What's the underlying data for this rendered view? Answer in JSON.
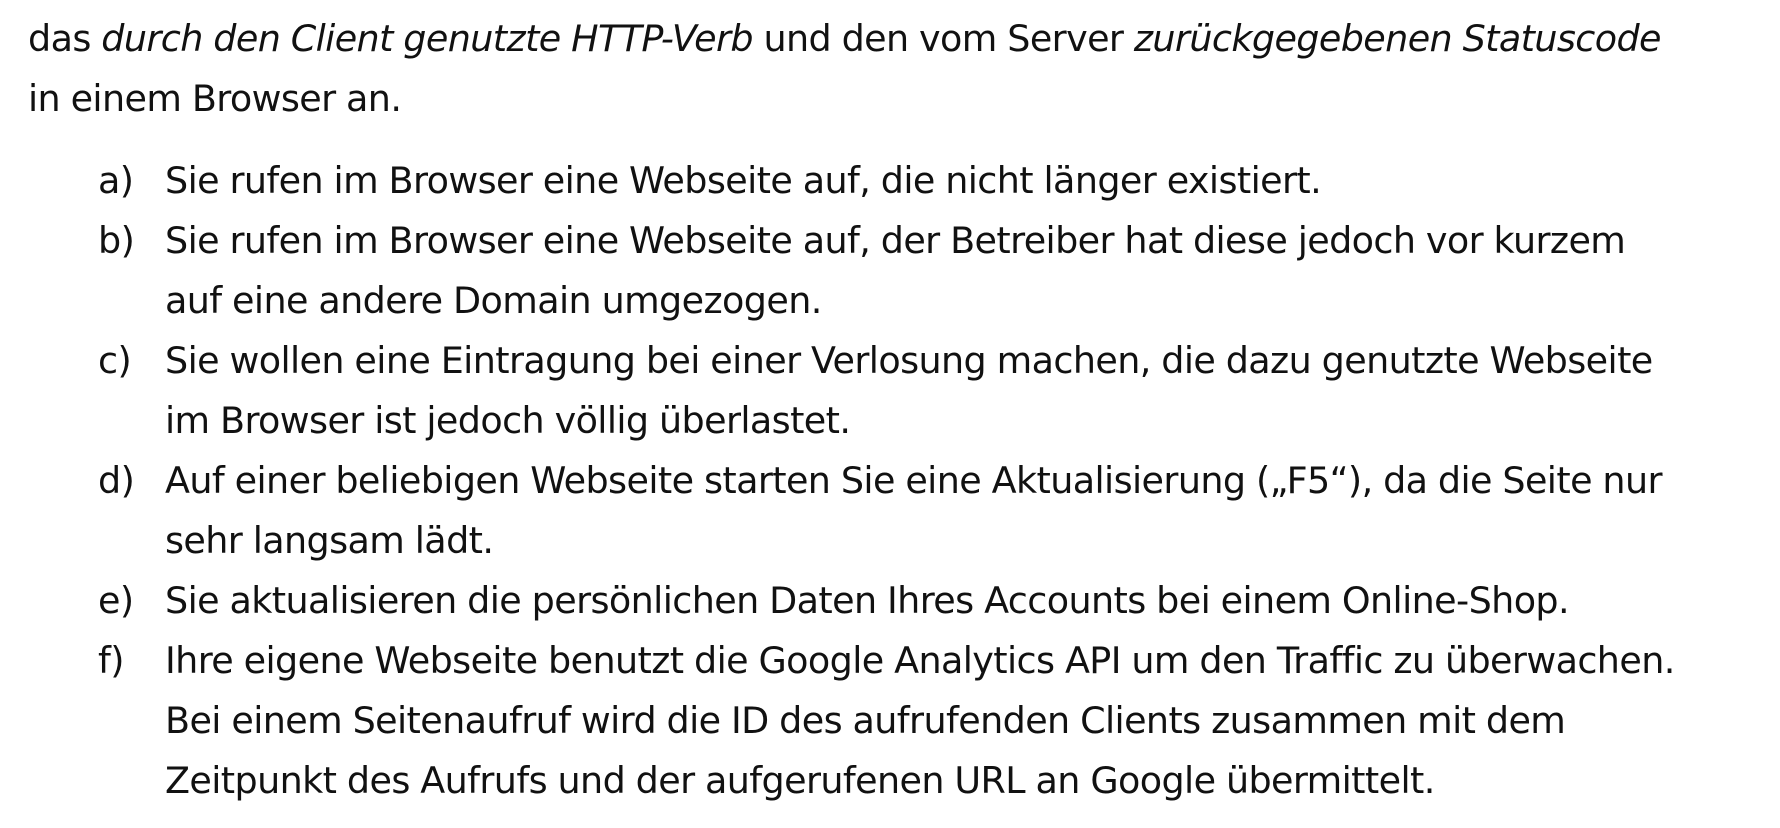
{
  "intro": {
    "segments": [
      {
        "text": "das ",
        "italic": false
      },
      {
        "text": "durch den Client genutzte HTTP-Verb",
        "italic": true
      },
      {
        "text": " und den vom Server ",
        "italic": false
      },
      {
        "text": "zurückgegebenen Statuscode",
        "italic": true
      }
    ],
    "line2": "in einem Browser an."
  },
  "items": [
    {
      "marker": "a)",
      "lines": [
        "Sie rufen im Browser eine Webseite auf, die nicht länger existiert."
      ]
    },
    {
      "marker": "b)",
      "lines": [
        "Sie rufen im Browser eine Webseite auf, der Betreiber hat diese jedoch vor kurzem",
        "auf eine andere Domain umgezogen."
      ]
    },
    {
      "marker": "c)",
      "lines": [
        "Sie wollen eine Eintragung bei einer Verlosung machen, die dazu genutzte Webseite",
        "im Browser ist jedoch völlig überlastet."
      ]
    },
    {
      "marker": "d)",
      "lines": [
        "Auf einer beliebigen Webseite starten Sie eine Aktualisierung („F5“), da die Seite nur",
        "sehr langsam lädt."
      ]
    },
    {
      "marker": "e)",
      "lines": [
        "Sie aktualisieren die persönlichen Daten Ihres Accounts bei einem Online-Shop."
      ]
    },
    {
      "marker": "f)",
      "lines": [
        "Ihre eigene Webseite benutzt die Google Analytics API um den Traffic zu überwachen.",
        "Bei einem Seitenaufruf wird die ID des aufrufenden Clients zusammen mit dem",
        "Zeitpunkt des Aufrufs und der aufgerufenen URL an Google übermittelt."
      ]
    }
  ]
}
